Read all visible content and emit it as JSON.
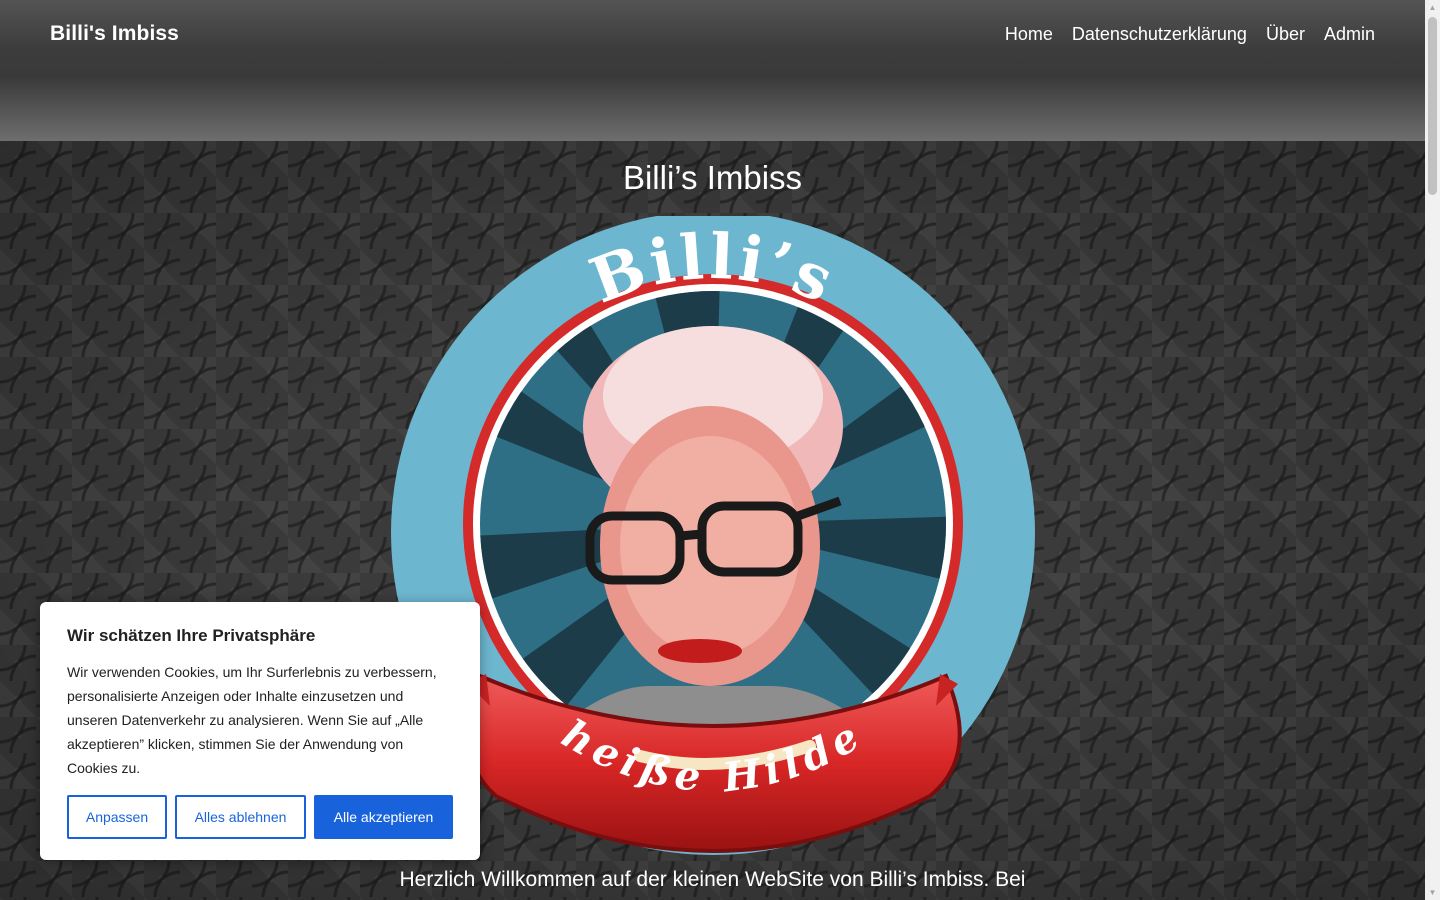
{
  "header": {
    "brand": "Billi's Imbiss",
    "nav": [
      "Home",
      "Datenschutzerklärung",
      "Über",
      "Admin"
    ]
  },
  "hero": {
    "title": "Billi’s Imbiss",
    "logo_top_text": "Billi’s",
    "logo_banner_text": "„heiße Hilde“",
    "welcome": "Herzlich Willkommen auf der kleinen WebSite von Billi’s Imbiss. Bei"
  },
  "cookie": {
    "title": "Wir schätzen Ihre Privatsphäre",
    "text": "Wir verwenden Cookies, um Ihr Surferlebnis zu verbessern, personalisierte Anzeigen oder Inhalte einzusetzen und unseren Datenverkehr zu analysieren. Wenn Sie auf „Alle akzeptieren” klicken, stimmen Sie der Anwendung von Cookies zu.",
    "customize": "Anpassen",
    "reject": "Alles ablehnen",
    "accept": "Alle akzeptieren"
  },
  "colors": {
    "accent": "#1863dc",
    "logo_blue": "#6db6cf",
    "logo_red": "#d42a2a"
  },
  "scrollbar": {
    "up": "▲",
    "down": "▼"
  }
}
